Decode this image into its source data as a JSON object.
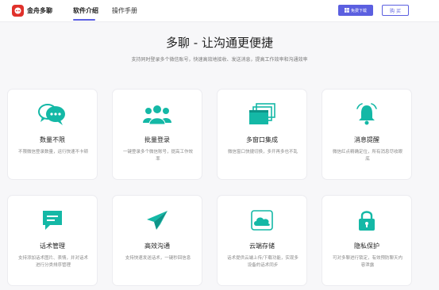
{
  "header": {
    "brand": "金舟多聊",
    "nav": [
      "软件介绍",
      "操作手册"
    ],
    "download_label": "免费下载",
    "buy_label": "购 买"
  },
  "hero": {
    "title": "多聊 - 让沟通更便捷",
    "subtitle": "支持同时登录多个微信账号，快速高效地接收、发送消息，提高工作效率和沟通效率"
  },
  "features": [
    {
      "title": "数量不限",
      "desc": "不限微信登录数量，运行快速不卡顿",
      "icon": "chat-bubbles-icon"
    },
    {
      "title": "批量登录",
      "desc": "一键登录多个微信账号，提高工作效率",
      "icon": "users-icon"
    },
    {
      "title": "多窗口集成",
      "desc": "微信窗口快捷切换，多开再多也不乱",
      "icon": "windows-icon"
    },
    {
      "title": "消息提醒",
      "desc": "微信红点精确定位，所有消息尽收眼底",
      "icon": "bell-icon"
    },
    {
      "title": "话术管理",
      "desc": "支持添加话术图片、表情，并对话术进行分类排序管理",
      "icon": "message-icon"
    },
    {
      "title": "高效沟通",
      "desc": "支持快速发送话术，一键秒回信息",
      "icon": "paper-plane-icon"
    },
    {
      "title": "云端存储",
      "desc": "话术提供云端上传/下载功能，实现多设备的话术同步",
      "icon": "cloud-storage-icon"
    },
    {
      "title": "隐私保护",
      "desc": "可对多聊进行锁定，有效预防聊天内容泄露",
      "icon": "lock-icon"
    }
  ],
  "colors": {
    "accent": "#5b5fe0",
    "icon": "#14b8a6",
    "brand": "#e0312b"
  }
}
